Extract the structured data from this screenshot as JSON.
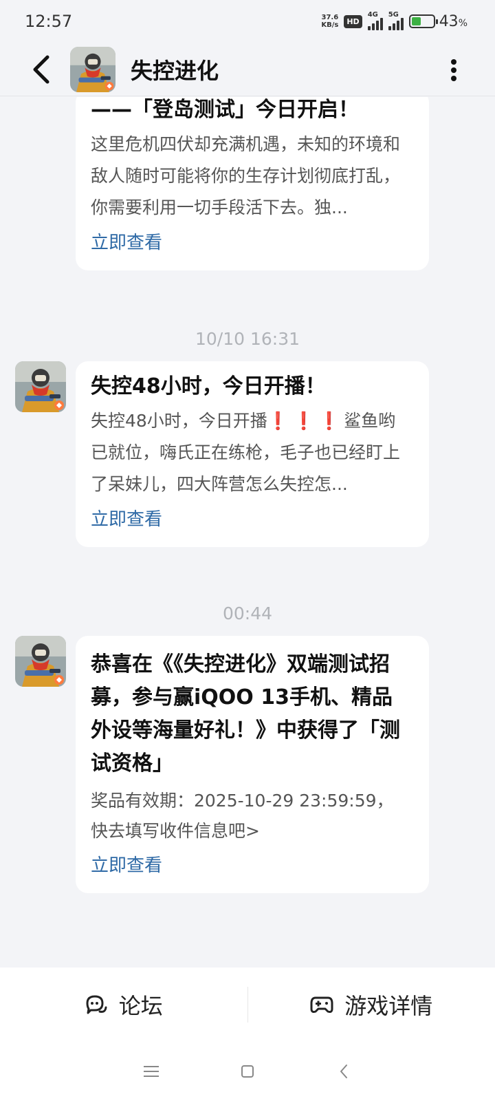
{
  "status_bar": {
    "time": "12:57",
    "net_speed_value": "37.6",
    "net_speed_unit": "KB/s",
    "hd_badge": "HD",
    "sim1_tag": "4G",
    "sim2_tag": "5G",
    "battery_level": 43,
    "battery_percent": "43",
    "battery_percent_sign": "%"
  },
  "header": {
    "title": "失控进化"
  },
  "messages": [
    {
      "title": "——「登岛测试」今日开启！",
      "body": "这里危机四伏却充满机遇，未知的环境和敌人随时可能将你的生存计划彻底打乱，你需要利用一切手段活下去。独...",
      "link": "立即查看"
    },
    {
      "time": "10/10  16:31",
      "title": "失控48小时，今日开播！",
      "body_prefix": "失控48小时，今日开播",
      "body_emphasis": "❗❗❗",
      "body_suffix": "鲨鱼哟已就位，嗨氏正在练枪，毛子也已经盯上了呆妹儿，四大阵营怎么失控怎...",
      "link": "立即查看"
    },
    {
      "time": "00:44",
      "title": "恭喜在《《失控进化》双端测试招募，参与赢iQOO 13手机、精品外设等海量好礼！》中获得了「测试资格」",
      "body_line1": "奖品有效期：2025-10-29 23:59:59，",
      "body_line2": "快去填写收件信息吧>",
      "link": "立即查看"
    }
  ],
  "bottom_bar": {
    "forum_label": "论坛",
    "game_details_label": "游戏详情"
  },
  "colors": {
    "background": "#f3f4f7",
    "card": "#ffffff",
    "link": "#2f6aa6",
    "emphasis": "#e53935",
    "battery": "#3cb043"
  }
}
